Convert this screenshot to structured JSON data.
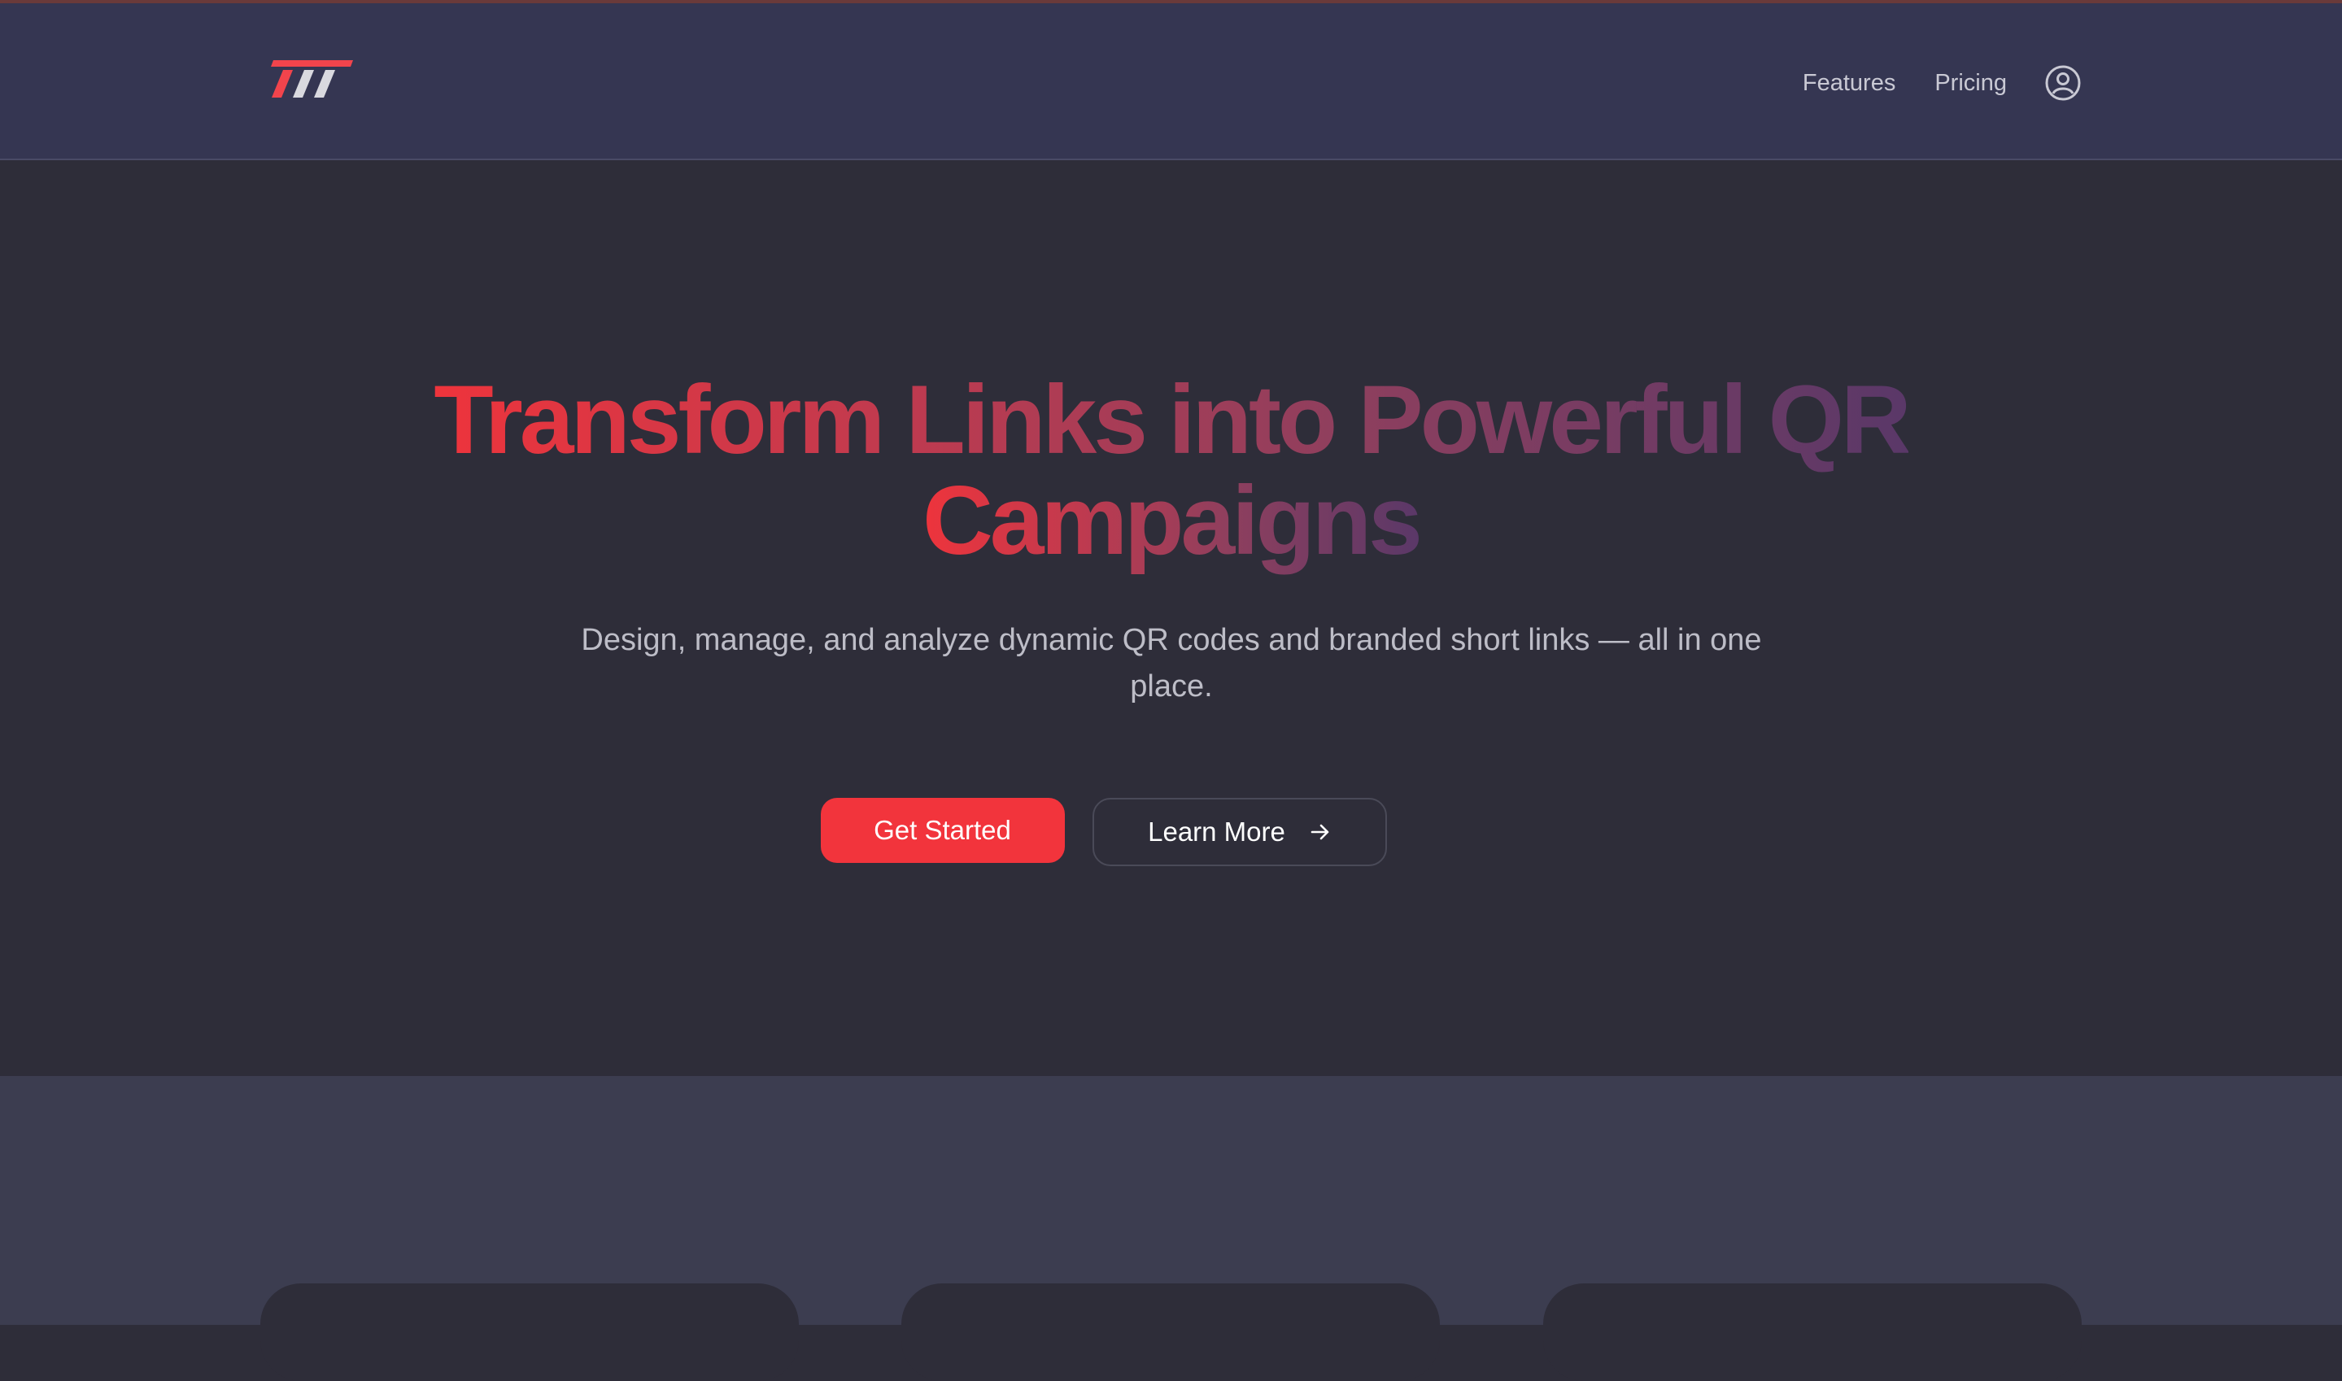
{
  "colors": {
    "accent": "#f2343c",
    "navbar_bg": "#353652",
    "hero_bg": "#2e2d39",
    "features_bg": "#3c3d50"
  },
  "logo": {
    "icon": "logo-stripes-icon"
  },
  "nav": {
    "features_label": "Features",
    "pricing_label": "Pricing",
    "account_icon": "user-circle-icon"
  },
  "hero": {
    "title_line1": "Transform Links into Powerful QR",
    "title_line2": "Campaigns",
    "subtitle": "Design, manage, and analyze dynamic QR codes and branded short links — all in one place.",
    "primary_cta": "Get Started",
    "secondary_cta": "Learn More",
    "secondary_cta_icon": "arrow-right-icon"
  }
}
